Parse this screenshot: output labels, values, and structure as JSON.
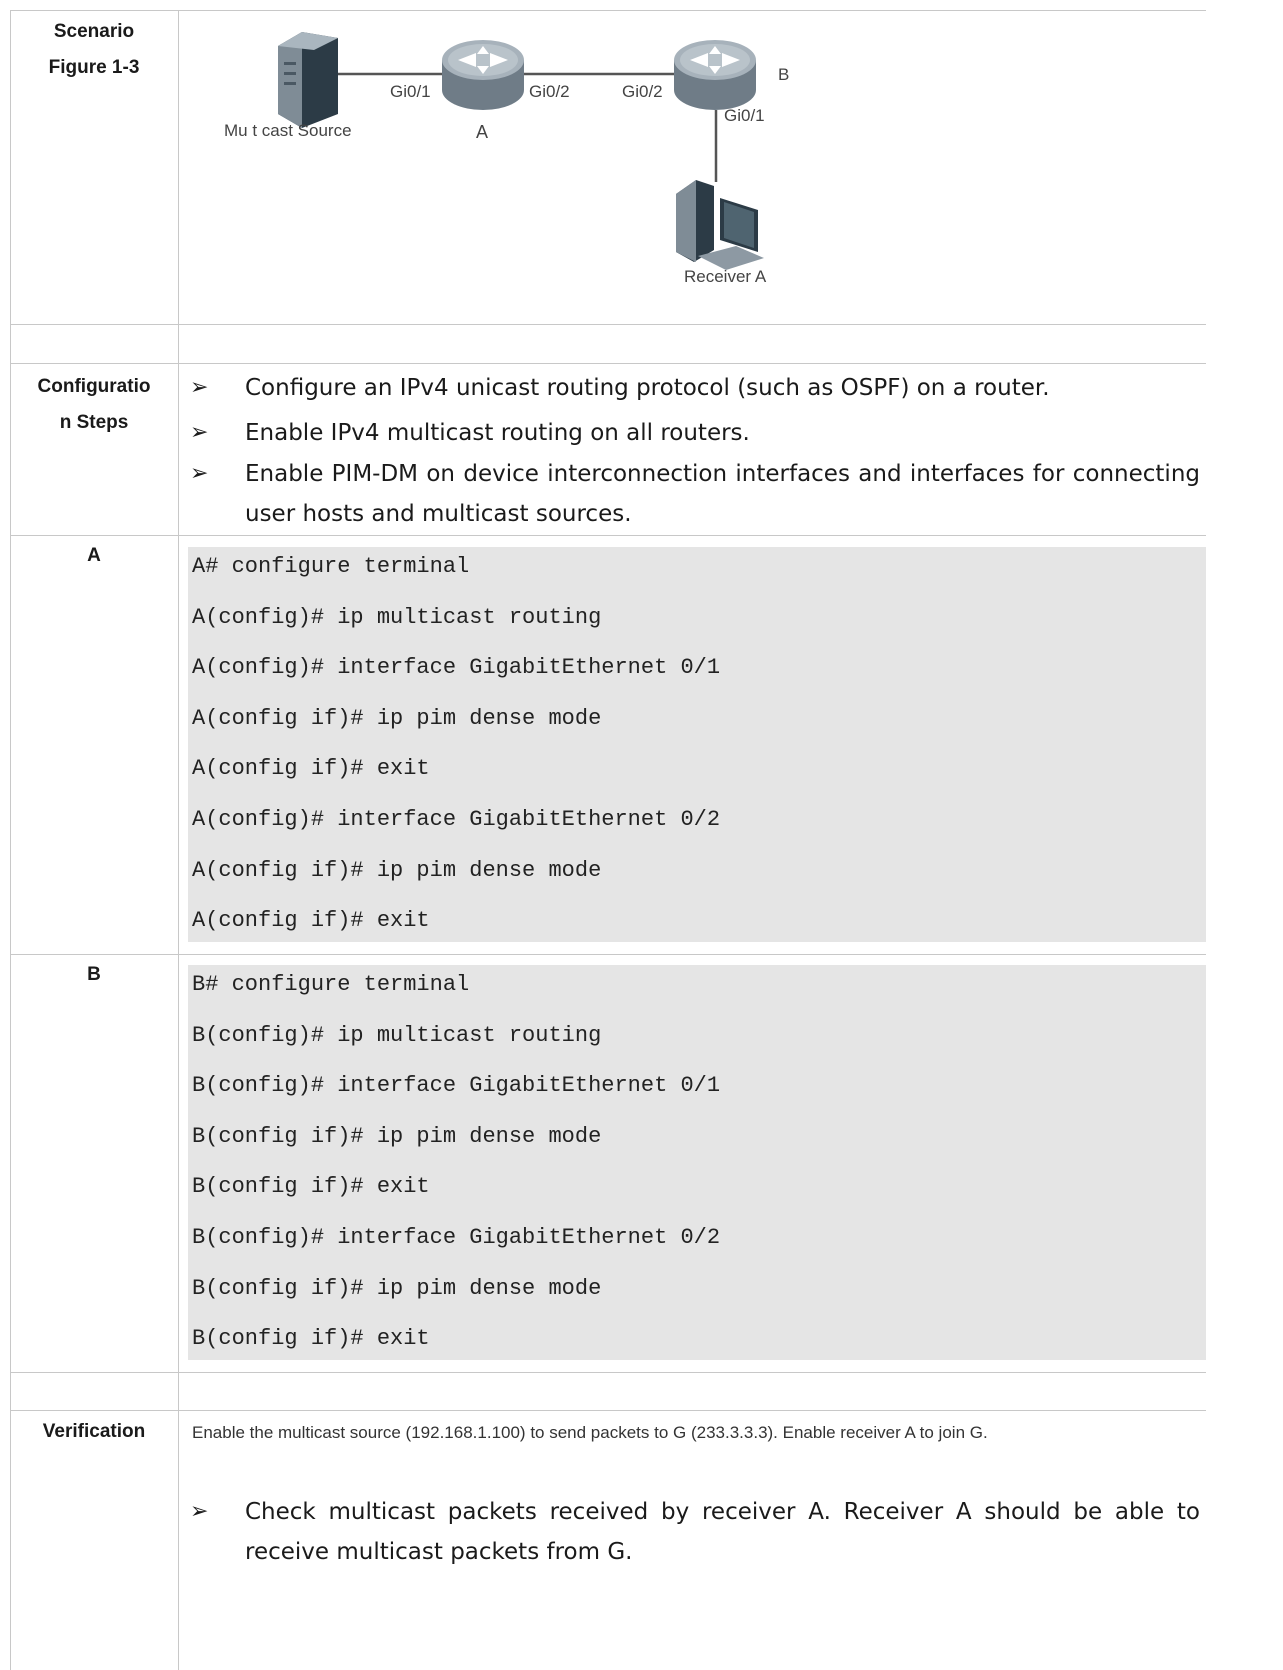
{
  "rows": {
    "scenario": {
      "label_line1": "Scenario",
      "label_line2": "Figure 1-3"
    },
    "config_steps": {
      "label_line1": "Configuratio",
      "label_line2": "n Steps",
      "bullets": [
        "Configure an IPv4 unicast routing protocol (such as OSPF) on a router.",
        "Enable IPv4 multicast routing on all routers.",
        "Enable PIM-DM on device interconnection interfaces and interfaces for connecting user hosts and multicast sources."
      ]
    },
    "device_a": {
      "label": "A",
      "lines": [
        "A# configure terminal",
        "A(config)# ip multicast routing",
        "A(config)# interface GigabitEthernet 0/1",
        "A(config if)# ip pim dense mode",
        "A(config if)# exit",
        "A(config)# interface GigabitEthernet 0/2",
        "A(config if)# ip pim dense mode",
        "A(config if)# exit"
      ]
    },
    "device_b": {
      "label": "B",
      "lines": [
        "B# configure terminal",
        "B(config)# ip multicast routing",
        "B(config)# interface GigabitEthernet 0/1",
        "B(config if)# ip pim dense mode",
        "B(config if)# exit",
        "B(config)# interface GigabitEthernet 0/2",
        "B(config if)# ip pim dense mode",
        "B(config if)# exit"
      ]
    },
    "verification": {
      "label": "Verification",
      "text": "Enable the multicast source (192.168.1.100) to send packets to G (233.3.3.3). Enable receiver A to join G.",
      "bullets": [
        "Check multicast packets received by receiver A. Receiver A should be able to receive multicast packets from G."
      ]
    }
  },
  "topology": {
    "source_label": "Mu t cast Source",
    "router_a_label": "A",
    "router_b_label": "B",
    "a_port1": "Gi0/1",
    "a_port2": "Gi0/2",
    "b_port2": "Gi0/2",
    "b_port1": "Gi0/1",
    "receiver_label": "Receiver A"
  },
  "bullet_glyph": "➢",
  "colors": {
    "border": "#c8c8c8",
    "code_bg": "#e5e5e5",
    "router": "#8e9aa5"
  }
}
